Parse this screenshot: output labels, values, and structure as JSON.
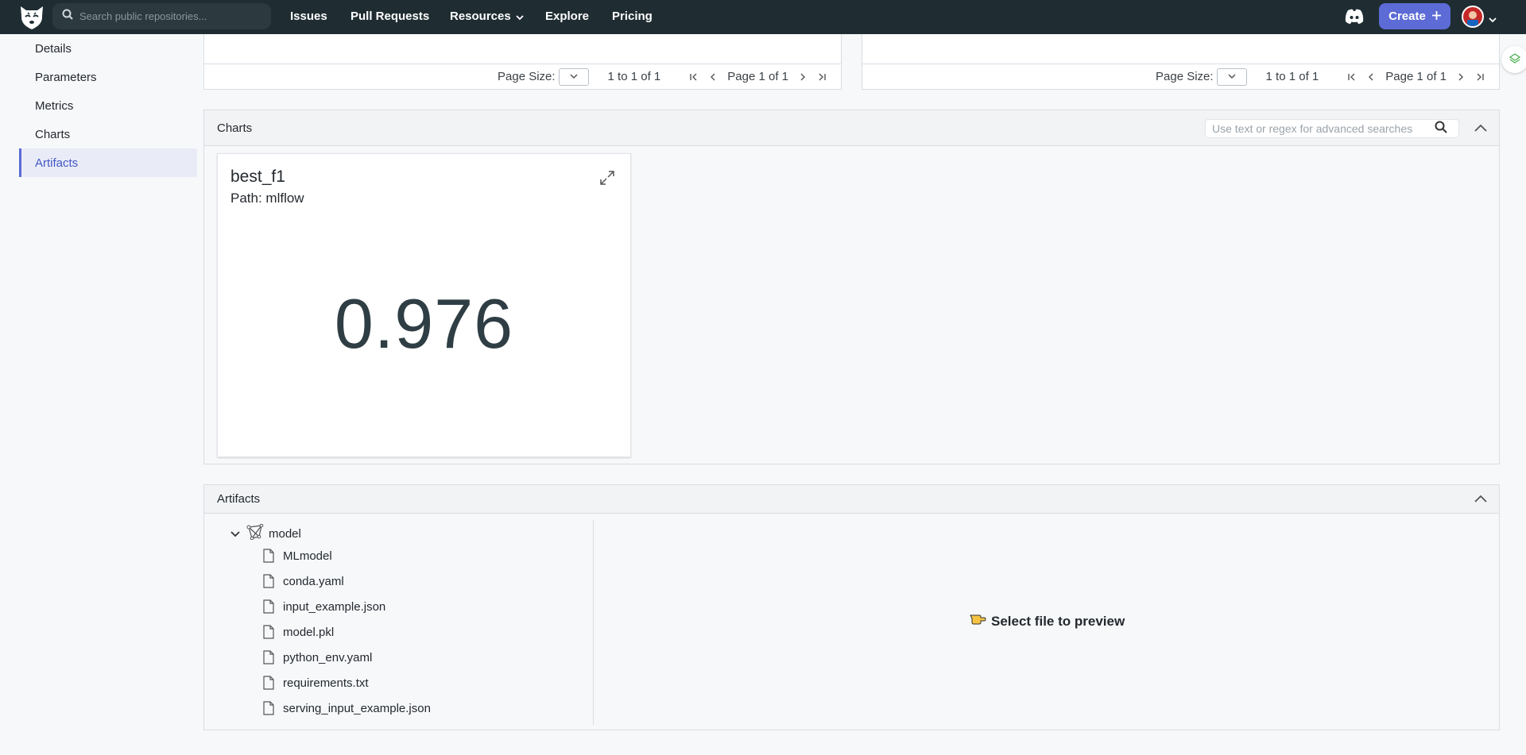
{
  "nav": {
    "search_placeholder": "Search public repositories...",
    "links": [
      "Issues",
      "Pull Requests",
      "Resources",
      "Explore",
      "Pricing"
    ],
    "create_label": "Create"
  },
  "sidebar": {
    "items": [
      {
        "label": "Details"
      },
      {
        "label": "Parameters"
      },
      {
        "label": "Metrics"
      },
      {
        "label": "Charts"
      },
      {
        "label": "Artifacts",
        "active": true
      }
    ]
  },
  "tables": [
    {
      "page_size_label": "Page Size:",
      "range": "1 to 1 of 1",
      "page": "Page 1 of 1"
    },
    {
      "page_size_label": "Page Size:",
      "range": "1 to 1 of 1",
      "page": "Page 1 of 1"
    }
  ],
  "charts_panel": {
    "title": "Charts",
    "search_placeholder": "Use text or regex for advanced searches",
    "card": {
      "title": "best_f1",
      "path": "Path: mlflow",
      "value": "0.976"
    }
  },
  "artifacts_panel": {
    "title": "Artifacts",
    "root": "model",
    "files": [
      "MLmodel",
      "conda.yaml",
      "input_example.json",
      "model.pkl",
      "python_env.yaml",
      "requirements.txt",
      "serving_input_example.json"
    ],
    "preview_text": "Select file to preview"
  },
  "colors": {
    "nav_bg": "#1f2d33",
    "accent": "#5c6bd6"
  }
}
